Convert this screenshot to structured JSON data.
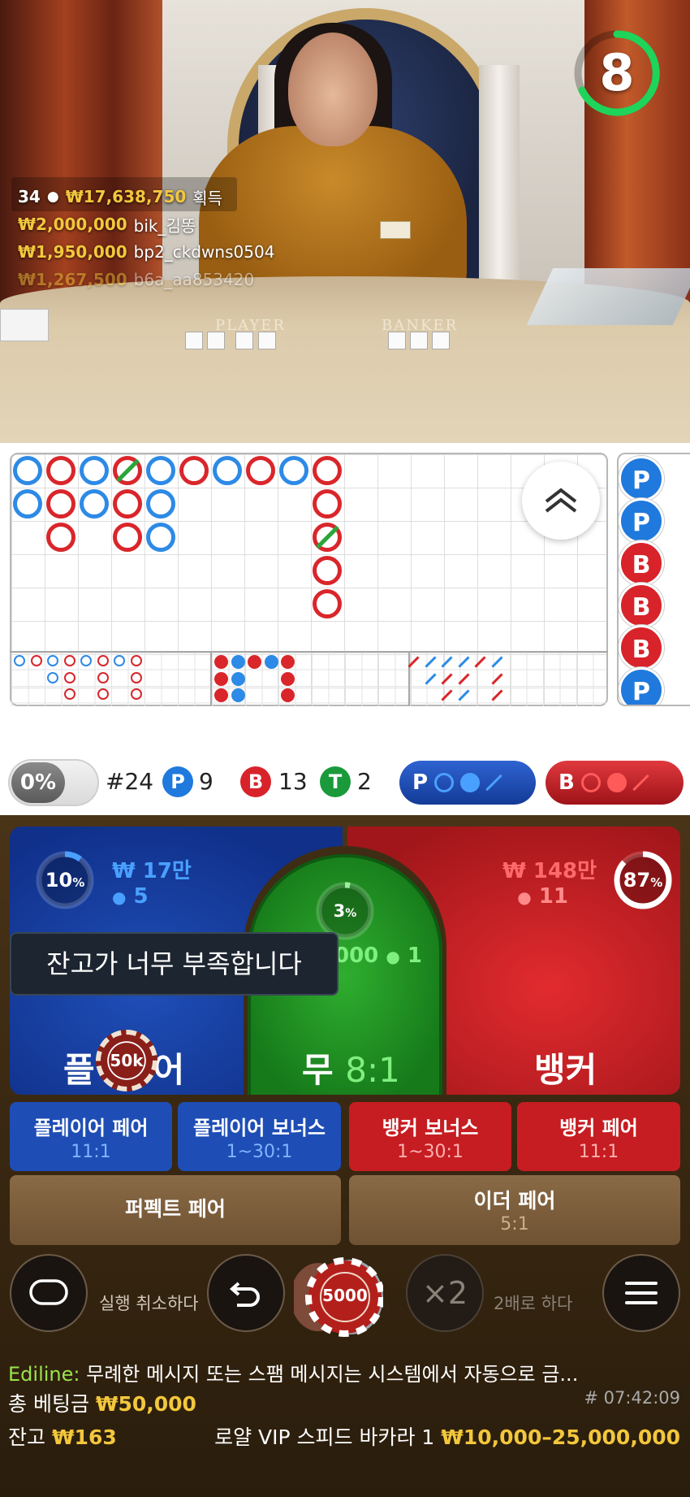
{
  "timer": "8",
  "winners": {
    "count": "34",
    "total": "₩17,638,750",
    "suffix": "획득",
    "rows": [
      {
        "amount": "₩2,000,000",
        "name": "bik_김똥"
      },
      {
        "amount": "₩1,950,000",
        "name": "bp2_ckdwns0504"
      },
      {
        "amount": "₩1,267,500",
        "name": "b6a_aa853420"
      }
    ]
  },
  "felt": {
    "player": "PLAYER",
    "banker": "BANKER"
  },
  "roadmap": {
    "bead_road": [
      "P",
      "P",
      "B",
      "B",
      "B",
      "P"
    ]
  },
  "stats": {
    "percent": "0%",
    "round": "#24",
    "player_letter": "P",
    "player_count": "9",
    "banker_letter": "B",
    "banker_count": "13",
    "tie_letter": "T",
    "tie_count": "2",
    "predict_p": "P",
    "predict_b": "B"
  },
  "bets": {
    "player": {
      "percent": 10,
      "percent_label": "10",
      "stake": "₩ 17만",
      "count": "5",
      "label_left": "플",
      "label_right": "어"
    },
    "banker": {
      "percent": 87,
      "percent_label": "87",
      "stake": "₩ 148만",
      "count": "11",
      "label": "뱅커"
    },
    "tie": {
      "percent": 3,
      "percent_label": "3",
      "stake": "000",
      "count": "1",
      "label": "무",
      "odds": "8:1"
    },
    "toast": "잔고가 너무 부족합니다",
    "chip": "50k"
  },
  "side_bets": [
    {
      "label": "플레이어 페어",
      "odds": "11:1"
    },
    {
      "label": "플레이어 보너스",
      "odds": "1~30:1"
    },
    {
      "label": "뱅커 보너스",
      "odds": "1~30:1"
    },
    {
      "label": "뱅커 페어",
      "odds": "11:1"
    },
    {
      "label": "퍼펙트 페어",
      "odds": ""
    },
    {
      "label": "이더 페어",
      "odds": "5:1"
    }
  ],
  "controls": {
    "undo_label": "실행 취소하다",
    "chip_value": "5000",
    "double_symbol": "×2",
    "double_label": "2배로 하다"
  },
  "chat": {
    "user": "Ediline:",
    "message": "무례한 메시지 또는 스팸 메시지는 시스템에서 자동으로 금..."
  },
  "footer": {
    "total_bet_label": "총 베팅금",
    "total_bet": "₩50,000",
    "balance_label": "잔고",
    "balance": "₩163",
    "time": "# 07:42:09",
    "table_name": "로얄 VIP 스피드 바카라 1",
    "limits": "₩10,000–25,000,000"
  },
  "colors": {
    "player": "#1e4db5",
    "banker": "#c61d22",
    "tie": "#2fae2f",
    "gold": "#f3c73c"
  }
}
